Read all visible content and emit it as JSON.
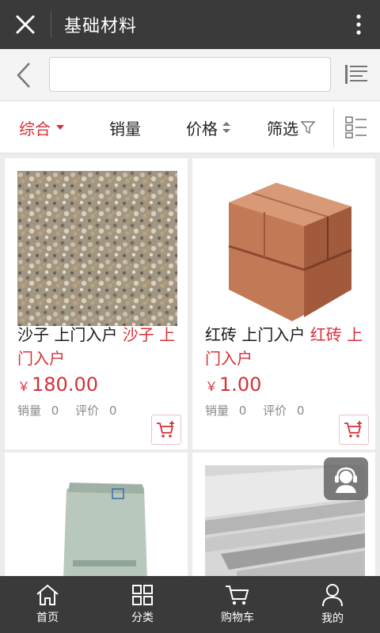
{
  "titlebar": {
    "title": "基础材料",
    "close_icon": "close-icon",
    "more_icon": "more-vertical-icon"
  },
  "search": {
    "value": "",
    "placeholder": "",
    "back_icon": "chevron-left-icon",
    "menu_icon": "list-menu-icon"
  },
  "sort": {
    "items": [
      {
        "label": "综合",
        "active": true,
        "icon": "caret-down-icon"
      },
      {
        "label": "销量",
        "active": false
      },
      {
        "label": "价格",
        "active": false,
        "icon": "sort-updown-icon"
      },
      {
        "label": "筛选",
        "active": false,
        "icon": "filter-icon"
      }
    ],
    "view_toggle_icon": "list-view-icon"
  },
  "products": [
    {
      "name": "沙子 上门入户",
      "name_red": "沙子 上门入户",
      "currency": "￥",
      "price": "180.00",
      "sales_label": "销量",
      "sales": "0",
      "reviews_label": "评价",
      "reviews": "0"
    },
    {
      "name": "红砖 上门入户",
      "name_red": "红砖 上门入户",
      "currency": "￥",
      "price": "1.00",
      "sales_label": "销量",
      "sales": "0",
      "reviews_label": "评价",
      "reviews": "0"
    },
    {
      "image": "cement-bag"
    },
    {
      "image": "steel-plates"
    }
  ],
  "bottomnav": [
    {
      "label": "首页",
      "icon": "home-icon"
    },
    {
      "label": "分类",
      "icon": "grid-icon"
    },
    {
      "label": "购物车",
      "icon": "cart-icon"
    },
    {
      "label": "我的",
      "icon": "user-icon"
    }
  ],
  "colors": {
    "accent": "#d6303a",
    "bar": "#3a3a3a"
  }
}
